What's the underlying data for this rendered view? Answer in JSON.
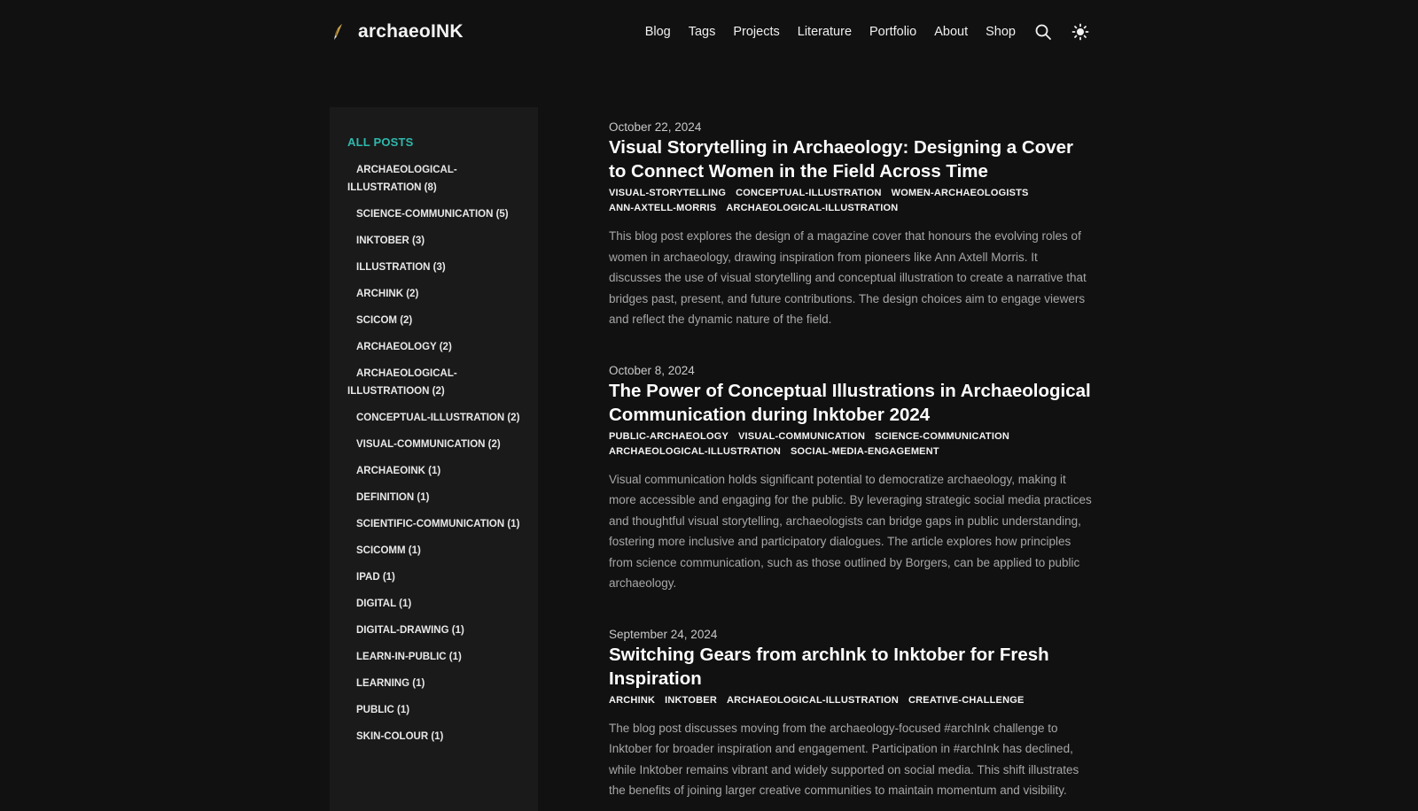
{
  "header": {
    "brand_name": "archaeoINK",
    "nav": [
      "Blog",
      "Tags",
      "Projects",
      "Literature",
      "Portfolio",
      "About",
      "Shop"
    ],
    "search_icon": "search-icon",
    "theme_icon": "sun-icon"
  },
  "sidebar": {
    "all_posts": "ALL POSTS",
    "tags": [
      "ARCHAEOLOGICAL-ILLUSTRATION (8)",
      "SCIENCE-COMMUNICATION (5)",
      "INKTOBER (3)",
      "ILLUSTRATION (3)",
      "ARCHINK (2)",
      "SCICOM (2)",
      "ARCHAEOLOGY (2)",
      "ARCHAEOLOGICAL-ILLUSTRATIOON (2)",
      "CONCEPTUAL-ILLUSTRATION (2)",
      "VISUAL-COMMUNICATION (2)",
      "ARCHAEOINK (1)",
      "DEFINITION (1)",
      "SCIENTIFIC-COMMUNICATION (1)",
      "SCICOMM (1)",
      "IPAD (1)",
      "DIGITAL (1)",
      "DIGITAL-DRAWING (1)",
      "LEARN-IN-PUBLIC (1)",
      "LEARNING (1)",
      "PUBLIC (1)",
      "SKIN-COLOUR (1)"
    ]
  },
  "posts": [
    {
      "date": "October 22, 2024",
      "title": "Visual Storytelling in Archaeology: Designing a Cover to Connect Women in the Field Across Time",
      "tags": [
        "VISUAL-STORYTELLING",
        "CONCEPTUAL-ILLUSTRATION",
        "WOMEN-ARCHAEOLOGISTS",
        "ANN-AXTELL-MORRIS",
        "ARCHAEOLOGICAL-ILLUSTRATION"
      ],
      "summary": "This blog post explores the design of a magazine cover that honours the evolving roles of women in archaeology, drawing inspiration from pioneers like Ann Axtell Morris. It discusses the use of visual storytelling and conceptual illustration to create a narrative that bridges past, present, and future contributions. The design choices aim to engage viewers and reflect the dynamic nature of the field."
    },
    {
      "date": "October 8, 2024",
      "title": "The Power of Conceptual Illustrations in Archaeological Communication during Inktober 2024",
      "tags": [
        "PUBLIC-ARCHAEOLOGY",
        "VISUAL-COMMUNICATION",
        "SCIENCE-COMMUNICATION",
        "ARCHAEOLOGICAL-ILLUSTRATION",
        "SOCIAL-MEDIA-ENGAGEMENT"
      ],
      "summary": "Visual communication holds significant potential to democratize archaeology, making it more accessible and engaging for the public. By leveraging strategic social media practices and thoughtful visual storytelling, archaeologists can bridge gaps in public understanding, fostering more inclusive and participatory dialogues. The article explores how principles from science communication, such as those outlined by Borgers, can be applied to public archaeology."
    },
    {
      "date": "September 24, 2024",
      "title": "Switching Gears from archInk to Inktober for Fresh Inspiration",
      "tags": [
        "ARCHINK",
        "INKTOBER",
        "ARCHAEOLOGICAL-ILLUSTRATION",
        "CREATIVE-CHALLENGE"
      ],
      "summary": "The blog post discusses moving from the archaeology-focused #archInk challenge to Inktober for broader inspiration and engagement. Participation in #archInk has declined, while Inktober remains vibrant and widely supported on social media. This shift illustrates the benefits of joining larger creative communities to maintain momentum and visibility."
    }
  ]
}
